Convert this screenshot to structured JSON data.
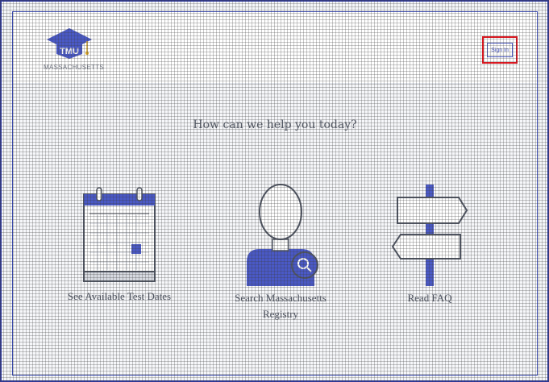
{
  "header": {
    "logo_text": "TMU",
    "logo_subtext": "MASSACHUSETTS",
    "signin_label": "Sign In"
  },
  "main": {
    "headline": "How can we help you today?",
    "options": [
      {
        "label": "See Available Test Dates",
        "icon": "calendar-icon"
      },
      {
        "label_line1": "Search Massachusetts",
        "label_line2": "Registry",
        "icon": "person-search-icon"
      },
      {
        "label": "Read FAQ",
        "icon": "signpost-icon"
      }
    ]
  },
  "colors": {
    "accent": "#4957c2",
    "highlight": "#e2161f",
    "frame": "#2f3a9e"
  }
}
